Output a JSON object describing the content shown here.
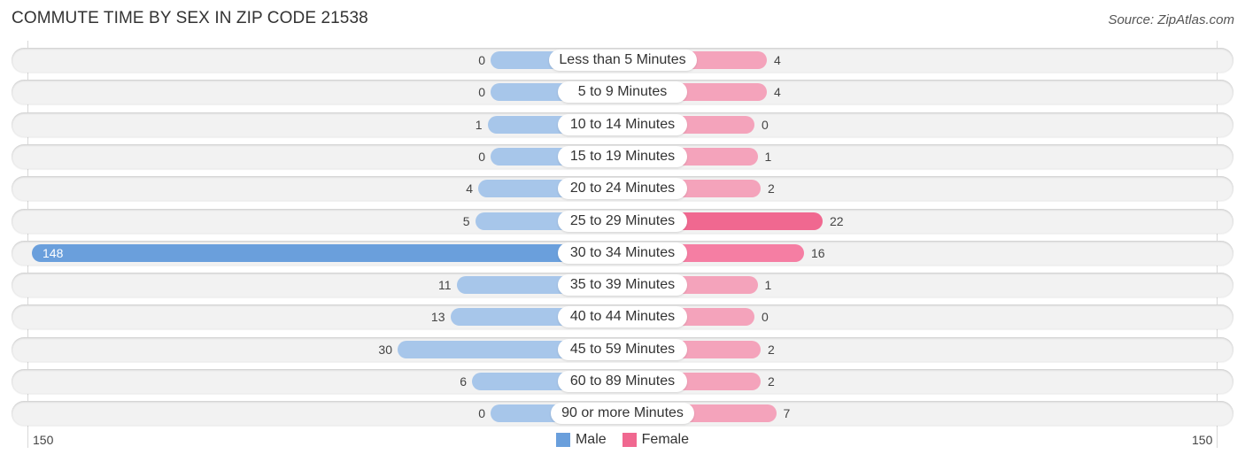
{
  "title": "COMMUTE TIME BY SEX IN ZIP CODE 21538",
  "source": "Source: ZipAtlas.com",
  "colors": {
    "male": "#a7c6ea",
    "male_strong": "#6a9fdc",
    "female": "#f4a3bb",
    "female_strong": "#f06890"
  },
  "chart_data": {
    "type": "bar",
    "orientation": "horizontal-diverging",
    "title": "COMMUTE TIME BY SEX IN ZIP CODE 21538",
    "categories": [
      "Less than 5 Minutes",
      "5 to 9 Minutes",
      "10 to 14 Minutes",
      "15 to 19 Minutes",
      "20 to 24 Minutes",
      "25 to 29 Minutes",
      "30 to 34 Minutes",
      "35 to 39 Minutes",
      "40 to 44 Minutes",
      "45 to 59 Minutes",
      "60 to 89 Minutes",
      "90 or more Minutes"
    ],
    "series": [
      {
        "name": "Male",
        "values": [
          0,
          0,
          1,
          0,
          4,
          5,
          148,
          11,
          13,
          30,
          6,
          0
        ]
      },
      {
        "name": "Female",
        "values": [
          4,
          4,
          0,
          1,
          2,
          22,
          16,
          1,
          0,
          2,
          2,
          7
        ]
      }
    ],
    "axis": {
      "left_tick": "150",
      "right_tick": "150",
      "range": [
        0,
        150
      ]
    },
    "legend": {
      "position": "bottom-center",
      "entries": [
        "Male",
        "Female"
      ]
    }
  }
}
